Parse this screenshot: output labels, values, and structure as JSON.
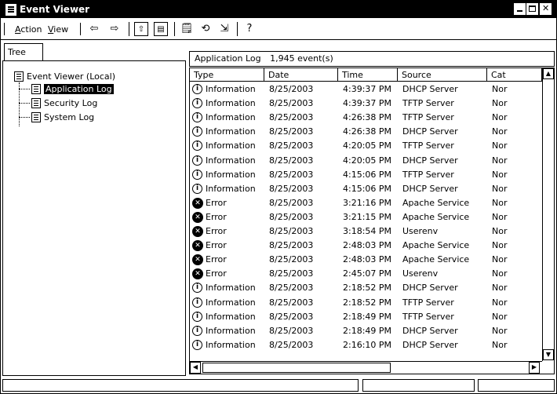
{
  "window": {
    "title": "Event Viewer"
  },
  "menu": {
    "action": "Action",
    "action_mnemonic": "A",
    "action_rest": "ction",
    "view": "View",
    "view_mnemonic": "V",
    "view_rest": "iew"
  },
  "toolbar_icons": [
    "back-arrow-icon",
    "forward-arrow-icon",
    "up-folder-icon",
    "show-hide-tree-icon",
    "properties-icon",
    "refresh-icon",
    "export-list-icon",
    "help-icon"
  ],
  "tree": {
    "tab_label": "Tree",
    "root": "Event Viewer (Local)",
    "items": [
      {
        "label": "Application Log",
        "selected": true
      },
      {
        "label": "Security Log",
        "selected": false
      },
      {
        "label": "System Log",
        "selected": false
      }
    ]
  },
  "list": {
    "header_title": "Application Log",
    "header_count": "1,945 event(s)",
    "columns": [
      "Type",
      "Date",
      "Time",
      "Source",
      "Cat"
    ],
    "rows": [
      {
        "type": "Information",
        "date": "8/25/2003",
        "time": "4:39:37 PM",
        "source": "DHCP Server",
        "cat": "Nor"
      },
      {
        "type": "Information",
        "date": "8/25/2003",
        "time": "4:39:37 PM",
        "source": "TFTP Server",
        "cat": "Nor"
      },
      {
        "type": "Information",
        "date": "8/25/2003",
        "time": "4:26:38 PM",
        "source": "TFTP Server",
        "cat": "Nor"
      },
      {
        "type": "Information",
        "date": "8/25/2003",
        "time": "4:26:38 PM",
        "source": "DHCP Server",
        "cat": "Nor"
      },
      {
        "type": "Information",
        "date": "8/25/2003",
        "time": "4:20:05 PM",
        "source": "TFTP Server",
        "cat": "Nor"
      },
      {
        "type": "Information",
        "date": "8/25/2003",
        "time": "4:20:05 PM",
        "source": "DHCP Server",
        "cat": "Nor"
      },
      {
        "type": "Information",
        "date": "8/25/2003",
        "time": "4:15:06 PM",
        "source": "TFTP Server",
        "cat": "Nor"
      },
      {
        "type": "Information",
        "date": "8/25/2003",
        "time": "4:15:06 PM",
        "source": "DHCP Server",
        "cat": "Nor"
      },
      {
        "type": "Error",
        "date": "8/25/2003",
        "time": "3:21:16 PM",
        "source": "Apache Service",
        "cat": "Nor"
      },
      {
        "type": "Error",
        "date": "8/25/2003",
        "time": "3:21:15 PM",
        "source": "Apache Service",
        "cat": "Nor"
      },
      {
        "type": "Error",
        "date": "8/25/2003",
        "time": "3:18:54 PM",
        "source": "Userenv",
        "cat": "Nor"
      },
      {
        "type": "Error",
        "date": "8/25/2003",
        "time": "2:48:03 PM",
        "source": "Apache Service",
        "cat": "Nor"
      },
      {
        "type": "Error",
        "date": "8/25/2003",
        "time": "2:48:03 PM",
        "source": "Apache Service",
        "cat": "Nor"
      },
      {
        "type": "Error",
        "date": "8/25/2003",
        "time": "2:45:07 PM",
        "source": "Userenv",
        "cat": "Nor"
      },
      {
        "type": "Information",
        "date": "8/25/2003",
        "time": "2:18:52 PM",
        "source": "DHCP Server",
        "cat": "Nor"
      },
      {
        "type": "Information",
        "date": "8/25/2003",
        "time": "2:18:52 PM",
        "source": "TFTP Server",
        "cat": "Nor"
      },
      {
        "type": "Information",
        "date": "8/25/2003",
        "time": "2:18:49 PM",
        "source": "TFTP Server",
        "cat": "Nor"
      },
      {
        "type": "Information",
        "date": "8/25/2003",
        "time": "2:18:49 PM",
        "source": "DHCP Server",
        "cat": "Nor"
      },
      {
        "type": "Information",
        "date": "8/25/2003",
        "time": "2:16:10 PM",
        "source": "DHCP Server",
        "cat": "Nor"
      }
    ]
  },
  "icon_glyphs": {
    "info": "i",
    "error": "✕"
  }
}
